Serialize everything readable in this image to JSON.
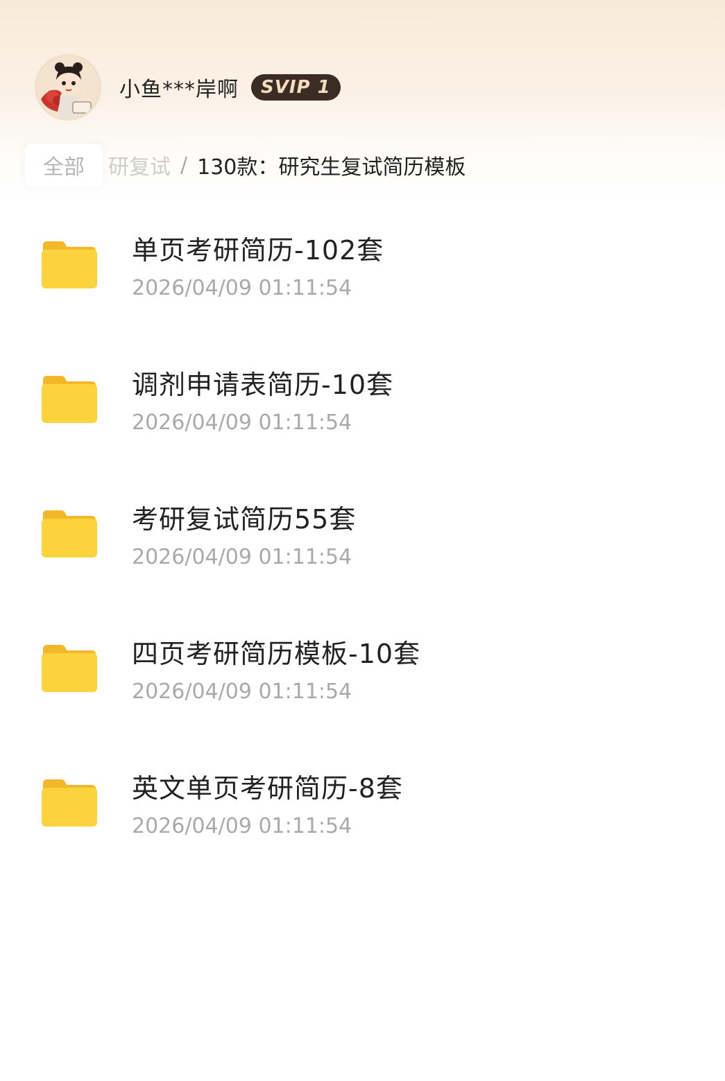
{
  "header": {
    "username": "小鱼***岸啊",
    "vip_badge": "SVIP 1"
  },
  "breadcrumb": {
    "root": "全部",
    "middle": "研复试",
    "separator": "/",
    "current": "130款：研究生复试简历模板"
  },
  "files": [
    {
      "name": "单页考研简历-102套",
      "time": "2026/04/09 01:11:54",
      "icon": "folder-icon"
    },
    {
      "name": "调剂申请表简历-10套",
      "time": "2026/04/09 01:11:54",
      "icon": "folder-icon"
    },
    {
      "name": "考研复试简历55套",
      "time": "2026/04/09 01:11:54",
      "icon": "folder-icon"
    },
    {
      "name": "四页考研简历模板-10套",
      "time": "2026/04/09 01:11:54",
      "icon": "folder-icon"
    },
    {
      "name": "英文单页考研简历-8套",
      "time": "2026/04/09 01:11:54",
      "icon": "folder-icon"
    }
  ],
  "colors": {
    "folder": "#fbd33c",
    "vip_badge_bg": "#3b2c25",
    "vip_badge_text": "#f4dcc0",
    "header_bg": "#f8ead8"
  }
}
